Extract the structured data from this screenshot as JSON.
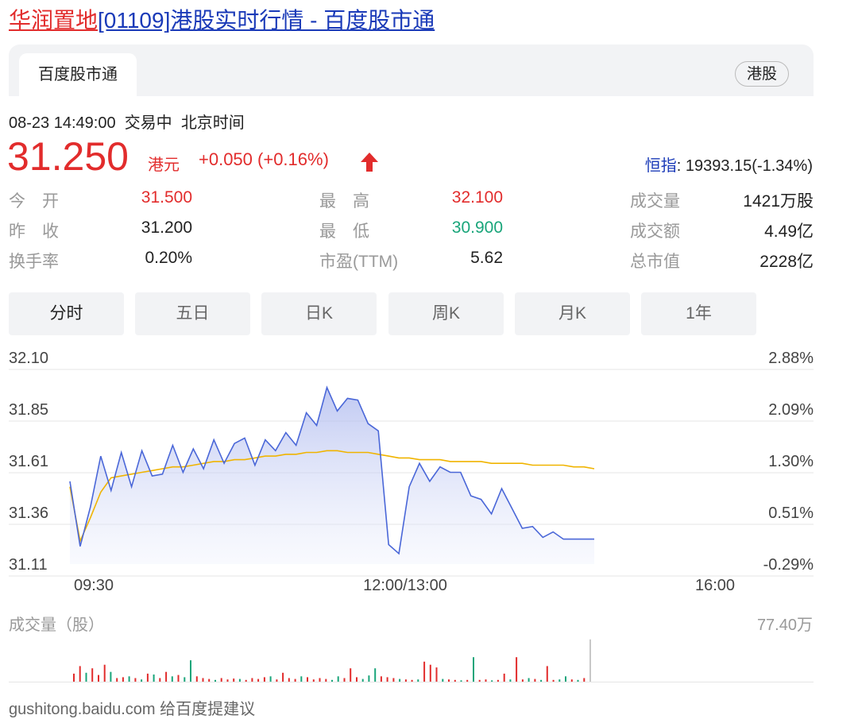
{
  "header": {
    "title_stock": "华润置地",
    "title_code": "[01109]",
    "title_rest": "港股实时行情 - 百度股市通"
  },
  "card": {
    "tab_label": "百度股市通",
    "market_badge": "港股"
  },
  "status": {
    "datetime": "08-23 14:49:00",
    "trade_state": "交易中",
    "timezone": "北京时间"
  },
  "quote": {
    "price": "31.250",
    "currency": "港元",
    "change": "+0.050 (+0.16%)",
    "index_label": "恒指",
    "index_value": ": 19393.15(-1.34%)"
  },
  "stats": [
    {
      "label": "今　开",
      "value": "31.500",
      "color": "#e22c2c"
    },
    {
      "label": "昨　收",
      "value": "31.200",
      "color": "#222222"
    },
    {
      "label": "换手率",
      "value": "0.20%",
      "color": "#222222"
    },
    {
      "label": "最　高",
      "value": "32.100",
      "color": "#e22c2c"
    },
    {
      "label": "最　低",
      "value": "30.900",
      "color": "#19a57a"
    },
    {
      "label": "市盈(TTM)",
      "value": "5.62",
      "color": "#222222"
    },
    {
      "label": "成交量",
      "value": "1421万股",
      "color": "#222222"
    },
    {
      "label": "成交额",
      "value": "4.49亿",
      "color": "#222222"
    },
    {
      "label": "总市值",
      "value": "2228亿",
      "color": "#222222"
    }
  ],
  "period_tabs": [
    "分时",
    "五日",
    "日K",
    "周K",
    "月K",
    "1年"
  ],
  "chart_data": {
    "type": "line",
    "y_price_ticks": [
      "32.10",
      "31.85",
      "31.61",
      "31.36",
      "31.11"
    ],
    "y_pct_ticks": [
      "2.88%",
      "2.09%",
      "1.30%",
      "0.51%",
      "-0.29%"
    ],
    "x_ticks": [
      "09:30",
      "12:00/13:00",
      "16:00"
    ],
    "ylim": [
      31.11,
      32.1
    ],
    "series": [
      {
        "role": "price",
        "color": "#4a67d8",
        "values": [
          31.48,
          31.12,
          31.34,
          31.62,
          31.43,
          31.64,
          31.45,
          31.65,
          31.51,
          31.52,
          31.68,
          31.53,
          31.66,
          31.55,
          31.71,
          31.58,
          31.69,
          31.72,
          31.57,
          31.71,
          31.65,
          31.75,
          31.68,
          31.86,
          31.79,
          32.0,
          31.87,
          31.94,
          31.93,
          31.8,
          31.76,
          31.13,
          31.08,
          31.45,
          31.58,
          31.48,
          31.56,
          31.53,
          31.53,
          31.4,
          31.38,
          31.3,
          31.44,
          31.33,
          31.22,
          31.23,
          31.17,
          31.2,
          31.16,
          31.16,
          31.16,
          31.16
        ]
      },
      {
        "role": "avg",
        "color": "#f0b400",
        "values": [
          31.45,
          31.15,
          31.28,
          31.42,
          31.5,
          31.51,
          31.52,
          31.53,
          31.54,
          31.55,
          31.56,
          31.56,
          31.57,
          31.58,
          31.59,
          31.59,
          31.6,
          31.6,
          31.61,
          31.62,
          31.62,
          31.63,
          31.63,
          31.64,
          31.64,
          31.65,
          31.65,
          31.64,
          31.64,
          31.64,
          31.63,
          31.62,
          31.61,
          31.61,
          31.6,
          31.6,
          31.6,
          31.59,
          31.59,
          31.59,
          31.59,
          31.58,
          31.58,
          31.58,
          31.58,
          31.57,
          31.57,
          31.57,
          31.57,
          31.56,
          31.56,
          31.55
        ]
      }
    ]
  },
  "volume": {
    "label": "成交量（股）",
    "max_label": "77.40万",
    "bars": [
      {
        "v": 0.18,
        "c": "r"
      },
      {
        "v": 0.35,
        "c": "r"
      },
      {
        "v": 0.2,
        "c": "g"
      },
      {
        "v": 0.3,
        "c": "r"
      },
      {
        "v": 0.15,
        "c": "r"
      },
      {
        "v": 0.38,
        "c": "r"
      },
      {
        "v": 0.22,
        "c": "g"
      },
      {
        "v": 0.08,
        "c": "r"
      },
      {
        "v": 0.1,
        "c": "r"
      },
      {
        "v": 0.12,
        "c": "g"
      },
      {
        "v": 0.08,
        "c": "r"
      },
      {
        "v": 0.05,
        "c": "g"
      },
      {
        "v": 0.18,
        "c": "r"
      },
      {
        "v": 0.16,
        "c": "g"
      },
      {
        "v": 0.08,
        "c": "r"
      },
      {
        "v": 0.22,
        "c": "r"
      },
      {
        "v": 0.12,
        "c": "g"
      },
      {
        "v": 0.15,
        "c": "r"
      },
      {
        "v": 0.1,
        "c": "g"
      },
      {
        "v": 0.48,
        "c": "g"
      },
      {
        "v": 0.12,
        "c": "r"
      },
      {
        "v": 0.08,
        "c": "r"
      },
      {
        "v": 0.06,
        "c": "r"
      },
      {
        "v": 0.04,
        "c": "g"
      },
      {
        "v": 0.08,
        "c": "r"
      },
      {
        "v": 0.05,
        "c": "r"
      },
      {
        "v": 0.07,
        "c": "r"
      },
      {
        "v": 0.06,
        "c": "g"
      },
      {
        "v": 0.04,
        "c": "r"
      },
      {
        "v": 0.08,
        "c": "r"
      },
      {
        "v": 0.06,
        "c": "r"
      },
      {
        "v": 0.1,
        "c": "r"
      },
      {
        "v": 0.12,
        "c": "g"
      },
      {
        "v": 0.05,
        "c": "r"
      },
      {
        "v": 0.2,
        "c": "r"
      },
      {
        "v": 0.08,
        "c": "r"
      },
      {
        "v": 0.06,
        "c": "r"
      },
      {
        "v": 0.12,
        "c": "g"
      },
      {
        "v": 0.1,
        "c": "r"
      },
      {
        "v": 0.05,
        "c": "r"
      },
      {
        "v": 0.08,
        "c": "r"
      },
      {
        "v": 0.06,
        "c": "r"
      },
      {
        "v": 0.04,
        "c": "g"
      },
      {
        "v": 0.12,
        "c": "g"
      },
      {
        "v": 0.08,
        "c": "r"
      },
      {
        "v": 0.3,
        "c": "r"
      },
      {
        "v": 0.1,
        "c": "r"
      },
      {
        "v": 0.06,
        "c": "g"
      },
      {
        "v": 0.14,
        "c": "g"
      },
      {
        "v": 0.3,
        "c": "g"
      },
      {
        "v": 0.12,
        "c": "r"
      },
      {
        "v": 0.1,
        "c": "r"
      },
      {
        "v": 0.08,
        "c": "r"
      },
      {
        "v": 0.06,
        "c": "g"
      },
      {
        "v": 0.05,
        "c": "r"
      },
      {
        "v": 0.04,
        "c": "r"
      },
      {
        "v": 0.05,
        "c": "g"
      },
      {
        "v": 0.45,
        "c": "r"
      },
      {
        "v": 0.38,
        "c": "r"
      },
      {
        "v": 0.32,
        "c": "r"
      },
      {
        "v": 0.06,
        "c": "g"
      },
      {
        "v": 0.05,
        "c": "r"
      },
      {
        "v": 0.04,
        "c": "r"
      },
      {
        "v": 0.03,
        "c": "g"
      },
      {
        "v": 0.04,
        "c": "r"
      },
      {
        "v": 0.55,
        "c": "g"
      },
      {
        "v": 0.04,
        "c": "r"
      },
      {
        "v": 0.05,
        "c": "r"
      },
      {
        "v": 0.03,
        "c": "g"
      },
      {
        "v": 0.04,
        "c": "r"
      },
      {
        "v": 0.18,
        "c": "r"
      },
      {
        "v": 0.05,
        "c": "g"
      },
      {
        "v": 0.55,
        "c": "r"
      },
      {
        "v": 0.05,
        "c": "r"
      },
      {
        "v": 0.08,
        "c": "g"
      },
      {
        "v": 0.06,
        "c": "r"
      },
      {
        "v": 0.04,
        "c": "g"
      },
      {
        "v": 0.35,
        "c": "r"
      },
      {
        "v": 0.04,
        "c": "r"
      },
      {
        "v": 0.05,
        "c": "g"
      },
      {
        "v": 0.12,
        "c": "g"
      },
      {
        "v": 0.05,
        "c": "r"
      },
      {
        "v": 0.04,
        "c": "g"
      },
      {
        "v": 0.08,
        "c": "r"
      },
      {
        "v": 0.95,
        "c": "x"
      }
    ]
  },
  "footer": {
    "text": "gushitong.baidu.com  给百度提建议"
  }
}
